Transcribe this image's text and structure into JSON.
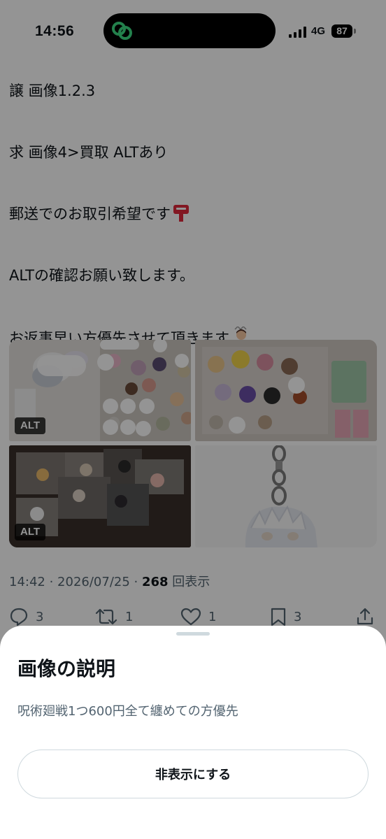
{
  "status_bar": {
    "time": "14:56",
    "network": "4G",
    "battery": "87"
  },
  "tweet": {
    "lines": [
      "譲 画像1.2.3",
      "求 画像4>買取 ALTあり",
      "郵送でのお取引希望です",
      "ALTの確認お願い致します。",
      "お返事早い方優先させて頂きます"
    ],
    "emoji_icons": [
      "postbox-icon",
      "person-gesturing-ok-icon"
    ],
    "media": [
      {
        "alt_badge": "ALT"
      },
      {
        "alt_badge": ""
      },
      {
        "alt_badge": "ALT"
      },
      {
        "alt_badge": ""
      }
    ],
    "meta": {
      "time": "14:42",
      "date": "2026/07/25",
      "views_count": "268",
      "views_label": "回表示"
    },
    "actions": {
      "replies": "3",
      "retweets": "1",
      "likes": "1",
      "bookmarks": "3"
    }
  },
  "sheet": {
    "title": "画像の説明",
    "description": "呪術廻戦1つ600円全て纏めての方優先",
    "hide_button_label": "非表示にする"
  },
  "colors": {
    "secondary_text": "#536471",
    "primary_text": "#0f1419",
    "overlay": "rgba(0,0,0,0.42)",
    "island_icon": "#3ddc84"
  }
}
